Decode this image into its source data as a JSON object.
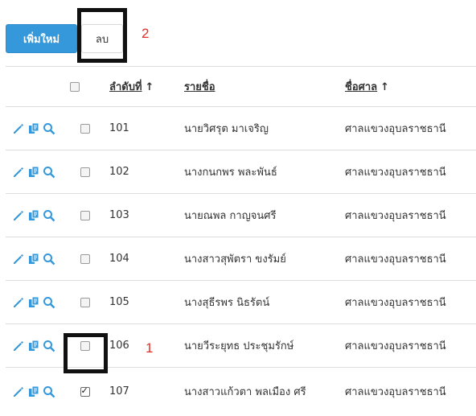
{
  "toolbar": {
    "add_label": "เพิ่มใหม่",
    "delete_label": "ลบ",
    "delete_marker": "2"
  },
  "table": {
    "columns": {
      "order": "ลำดับที่",
      "name": "รายชื่อ",
      "court": "ชื่อศาล",
      "sort_arrow": "↑"
    },
    "rows": [
      {
        "id": "101",
        "name": "นายวิศรุต มาเจริญ",
        "court": "ศาลแขวงอุบลราชธานี",
        "checked": false
      },
      {
        "id": "102",
        "name": "นางกนกพร พละพันธ์",
        "court": "ศาลแขวงอุบลราชธานี",
        "checked": false
      },
      {
        "id": "103",
        "name": "นายณพล กาญจนศรี",
        "court": "ศาลแขวงอุบลราชธานี",
        "checked": false
      },
      {
        "id": "104",
        "name": "นางสาวสุพัตรา ขงรัมย์",
        "court": "ศาลแขวงอุบลราชธานี",
        "checked": false
      },
      {
        "id": "105",
        "name": "นางสุธีรพร นิธรัตน์",
        "court": "ศาลแขวงอุบลราชธานี",
        "checked": false
      },
      {
        "id": "106",
        "name": "นายวีระยุทธ ประชุมรักษ์",
        "court": "ศาลแขวงอุบลราชธานี",
        "checked": false
      },
      {
        "id": "107",
        "name": "นางสาวแก้วตา พลเมือง ศรี",
        "court": "ศาลแขวงอุบลราชธานี",
        "checked": true,
        "marker": "1"
      }
    ]
  },
  "icons": {
    "edit": "pencil-icon",
    "copy": "copy-icon",
    "view": "search-icon"
  },
  "colors": {
    "accent": "#3498db",
    "marker": "#e0302a"
  }
}
